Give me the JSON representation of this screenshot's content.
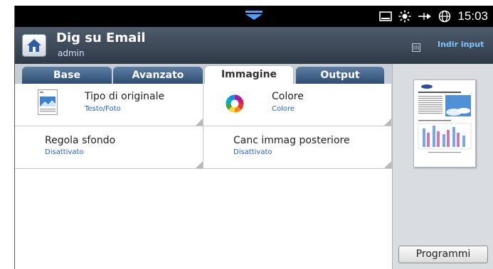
{
  "status_bar": {
    "time": "15:03",
    "icons": [
      "tray-icon",
      "sun-icon",
      "network-arrow-icon",
      "globe-icon"
    ]
  },
  "header": {
    "title": "Dig su Email",
    "user": "admin",
    "input_button_label": "Indir input"
  },
  "tabs": [
    {
      "label": "Base",
      "active": false
    },
    {
      "label": "Avanzato",
      "active": false
    },
    {
      "label": "Immagine",
      "active": true
    },
    {
      "label": "Output",
      "active": false
    }
  ],
  "options": {
    "original_type": {
      "label": "Tipo di originale",
      "value": "Testo/Foto"
    },
    "color": {
      "label": "Colore",
      "value": "Colore"
    },
    "background_adjust": {
      "label": "Regola sfondo",
      "value": "Disattivato"
    },
    "backside_erase": {
      "label": "Canc immag posteriore",
      "value": "Disattivato"
    }
  },
  "sidepanel": {
    "programs_button_label": "Programmi"
  },
  "colors": {
    "accent_blue": "#1f63c8",
    "header_dark": "#2f3a47",
    "tab_blue": "#2e4d74"
  }
}
